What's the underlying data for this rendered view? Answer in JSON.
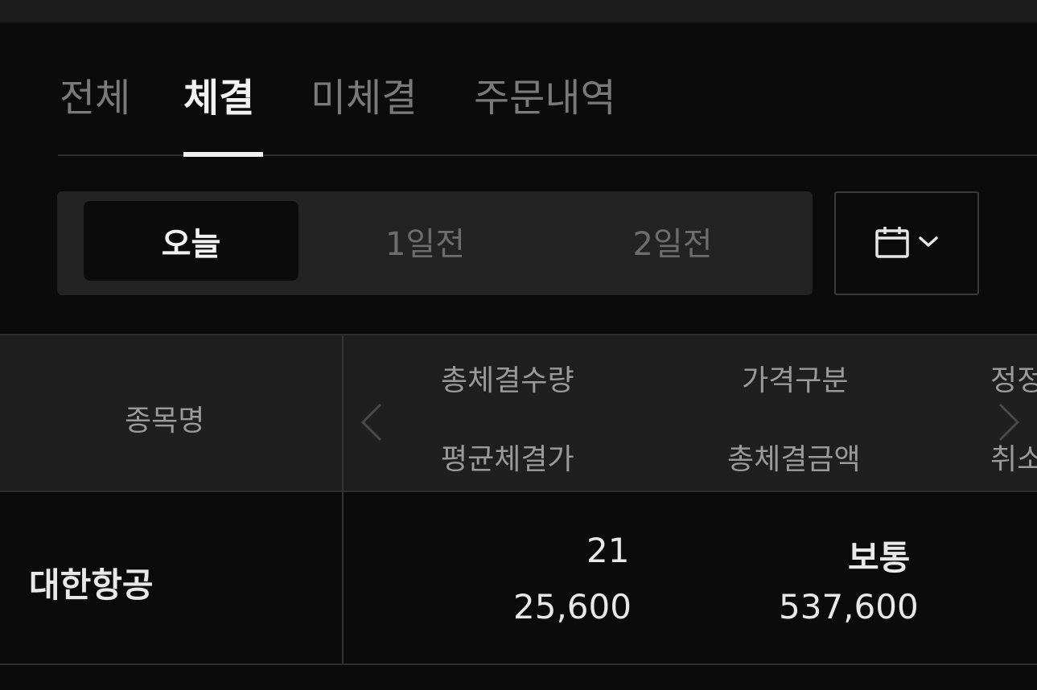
{
  "tabs": {
    "all": "전체",
    "filled": "체결",
    "unfilled": "미체결",
    "history": "주문내역",
    "active": "filled"
  },
  "period": {
    "today": "오늘",
    "one_day_ago": "1일전",
    "two_days_ago": "2일전",
    "selected": "today",
    "calendar_icon": "calendar-icon",
    "dropdown_icon": "chevron-down-icon"
  },
  "table": {
    "headers": {
      "stock_name": "종목명",
      "total_filled_qty": "총체결수량",
      "avg_filled_price": "평균체결가",
      "price_type": "가격구분",
      "total_filled_amount": "총체결금액",
      "next_col_top": "정정",
      "next_col_bottom": "취소"
    },
    "rows": [
      {
        "stock_name": "대한항공",
        "total_filled_qty": "21",
        "avg_filled_price": "25,600",
        "price_type": "보통",
        "total_filled_amount": "537,600"
      }
    ]
  },
  "colors": {
    "background": "#0b0b0b",
    "active_text": "#f2f2f2",
    "inactive_text": "#7a7a7a",
    "header_bg": "#1f1f1f",
    "segment_bg": "#232323"
  }
}
